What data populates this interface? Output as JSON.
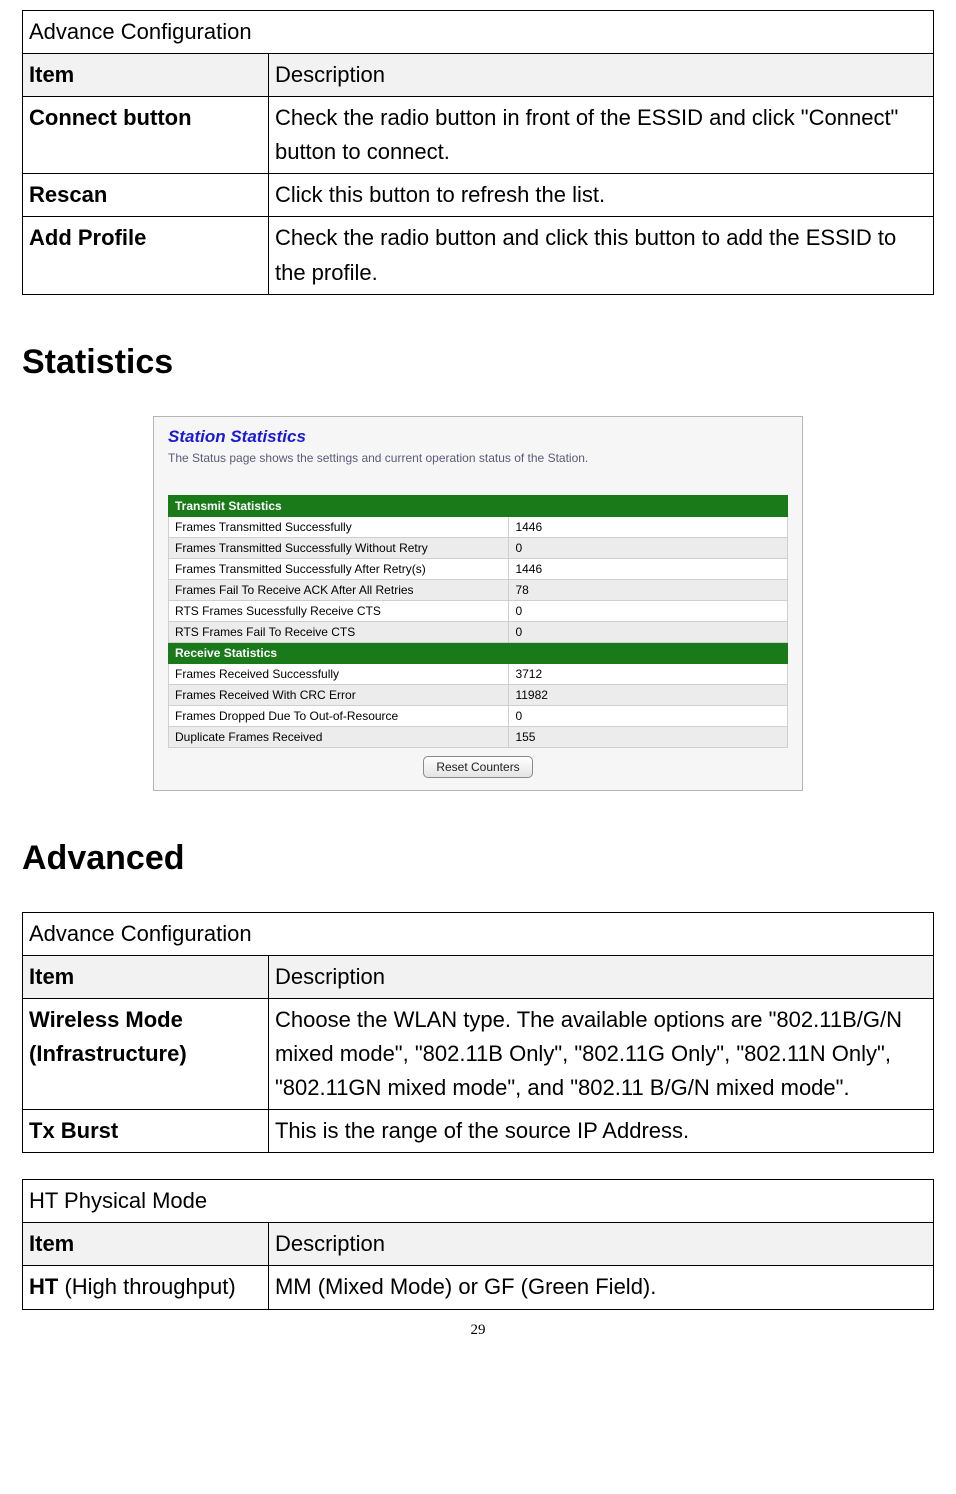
{
  "tables": {
    "top": {
      "caption": "Advance Configuration",
      "head": {
        "item": "Item",
        "desc": "Description"
      },
      "rows": [
        {
          "item": "Connect button",
          "desc": "Check the radio button in front of the ESSID and click \"Connect\" button to connect."
        },
        {
          "item": "Rescan",
          "desc": "Click this button to refresh the list."
        },
        {
          "item": "Add Profile",
          "desc": "Check the radio button and click this button to add the ESSID to the profile."
        }
      ]
    },
    "adv": {
      "caption": "Advance Configuration",
      "head": {
        "item": "Item",
        "desc": "Description"
      },
      "rows": [
        {
          "item": "Wireless Mode (Infrastructure)",
          "desc": "Choose the WLAN type. The available options are \"802.11B/G/N mixed mode\", \"802.11B Only\", \"802.11G Only\", \"802.11N Only\", \"802.11GN mixed mode\", and \"802.11 B/G/N mixed mode\"."
        },
        {
          "item": "Tx Burst",
          "desc": "This is the range of the source IP Address."
        }
      ]
    },
    "ht": {
      "caption": "HT Physical Mode",
      "head": {
        "item": "Item",
        "desc": "Description"
      },
      "rows": [
        {
          "item_bold": "HT",
          "item_rest": " (High throughput)",
          "desc": "MM (Mixed Mode) or GF (Green Field)."
        }
      ]
    }
  },
  "headings": {
    "statistics": "Statistics",
    "advanced": "Advanced"
  },
  "screenshot": {
    "title": "Station Statistics",
    "subtitle": "The Status page shows the settings and current operation status of the Station.",
    "tx_header": "Transmit Statistics",
    "rx_header": "Receive Statistics",
    "tx": [
      {
        "label": "Frames Transmitted Successfully",
        "value": "1446"
      },
      {
        "label": "Frames Transmitted Successfully Without Retry",
        "value": "0"
      },
      {
        "label": "Frames Transmitted Successfully After Retry(s)",
        "value": "1446"
      },
      {
        "label": "Frames Fail To Receive ACK After All Retries",
        "value": "78"
      },
      {
        "label": "RTS Frames Sucessfully Receive CTS",
        "value": "0"
      },
      {
        "label": "RTS Frames Fail To Receive CTS",
        "value": "0"
      }
    ],
    "rx": [
      {
        "label": "Frames Received Successfully",
        "value": "3712"
      },
      {
        "label": "Frames Received With CRC Error",
        "value": "11982"
      },
      {
        "label": "Frames Dropped Due To Out-of-Resource",
        "value": "0"
      },
      {
        "label": "Duplicate Frames Received",
        "value": "155"
      }
    ],
    "reset_label": "Reset Counters"
  },
  "page_number": "29"
}
